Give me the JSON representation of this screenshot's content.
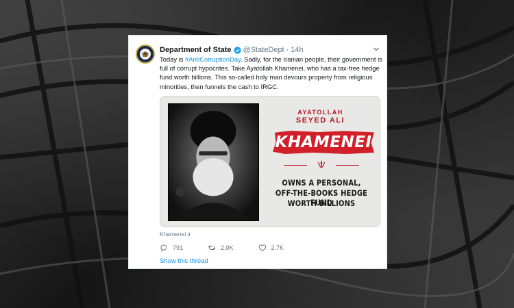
{
  "tweet": {
    "display_name": "Department of State",
    "handle": "@StateDept",
    "separator": "·",
    "time": "14h",
    "text_before_hashtag": "Today is ",
    "hashtag": "#AntiCorruptionDay",
    "text_after_hashtag": ". Sadly, for the Iranian people, their government is full of corrupt hypocrites. Take Ayatollah Khamenei, who has a tax-free hedge fund worth billions. This so-called holy man devours property from religious minorities, then funnels the cash to IRGC.",
    "source": "Khamenei.ir",
    "show_thread": "Show this thread"
  },
  "media": {
    "title_line1": "AYATOLLAH",
    "title_line2": "SEYED ALI",
    "name": "KHAMENEI",
    "claim_line1": "OWNS A PERSONAL,",
    "claim_line2": "OFF-THE-BOOKS HEDGE FUND",
    "claim_line3": "WORTH BILLIONS"
  },
  "actions": {
    "replies": "791",
    "retweets": "2.0K",
    "likes": "2.7K"
  },
  "colors": {
    "accent": "#1b95e0",
    "banner_red": "#d1202a",
    "text": "#14171a",
    "muted": "#657786"
  },
  "icons": [
    "verified-badge-icon",
    "chevron-down-icon",
    "reply-icon",
    "retweet-icon",
    "like-icon",
    "seal-avatar-icon",
    "emblem-icon"
  ]
}
